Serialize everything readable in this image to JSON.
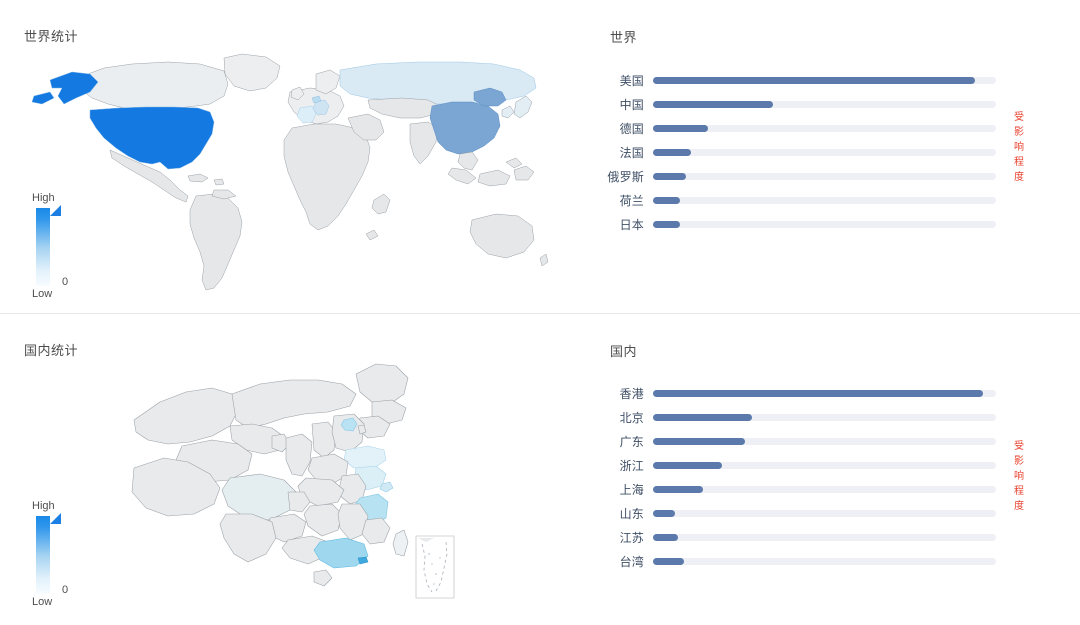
{
  "theme": {
    "bar_fill": "#5b7aab",
    "bar_track": "#eef0f5",
    "axis_title_color": "#e8422e",
    "map_high": "#1989e8",
    "map_base": "#e6e7e9",
    "divider": "#e8e8e8"
  },
  "world_panel": {
    "map_title": "世界统计",
    "legend": {
      "high": "High",
      "low": "Low",
      "zero": "0"
    },
    "highlighted_regions": [
      {
        "name": "United States",
        "shade": "#1479e0"
      },
      {
        "name": "China",
        "shade": "#7ba5d2"
      },
      {
        "name": "Russia",
        "shade": "#d9eaf4"
      },
      {
        "name": "Canada",
        "shade": "#eaeef0"
      },
      {
        "name": "Germany",
        "shade": "#cfe4f3"
      },
      {
        "name": "France",
        "shade": "#dceef8"
      },
      {
        "name": "Netherlands",
        "shade": "#bcdcf0"
      },
      {
        "name": "Japan",
        "shade": "#e3edf4"
      }
    ]
  },
  "domestic_panel": {
    "map_title": "国内统计",
    "legend": {
      "high": "High",
      "low": "Low",
      "zero": "0"
    },
    "highlighted_regions": [
      {
        "name": "Guangdong",
        "shade": "#9fd8ee"
      },
      {
        "name": "Zhejiang",
        "shade": "#b6e2f2"
      },
      {
        "name": "Beijing",
        "shade": "#b9e2f3"
      },
      {
        "name": "Shanghai",
        "shade": "#cfe9f5"
      },
      {
        "name": "Jiangsu",
        "shade": "#dbeff7"
      },
      {
        "name": "Shandong",
        "shade": "#e3f2f9"
      },
      {
        "name": "Taiwan",
        "shade": "#eef1f3"
      },
      {
        "name": "Hong Kong",
        "shade": "#3fa9dd"
      }
    ],
    "inset_label": ""
  },
  "chart_data": [
    {
      "type": "bar",
      "orientation": "horizontal",
      "title": "世界",
      "xlabel": "",
      "ylabel": "受影响程度",
      "categories": [
        "美国",
        "中国",
        "德国",
        "法国",
        "俄罗斯",
        "荷兰",
        "日本"
      ],
      "values": [
        94,
        35,
        16,
        11,
        9.5,
        8,
        8
      ],
      "xlim": [
        0,
        100
      ],
      "grid": false,
      "legend": "none"
    },
    {
      "type": "bar",
      "orientation": "horizontal",
      "title": "国内",
      "xlabel": "",
      "ylabel": "受影响程度",
      "categories": [
        "香港",
        "北京",
        "广东",
        "浙江",
        "上海",
        "山东",
        "江苏",
        "台湾"
      ],
      "values": [
        96,
        26,
        24,
        19,
        14,
        6,
        7,
        9
      ],
      "xlim": [
        0,
        100
      ],
      "grid": false,
      "legend": "none"
    }
  ]
}
